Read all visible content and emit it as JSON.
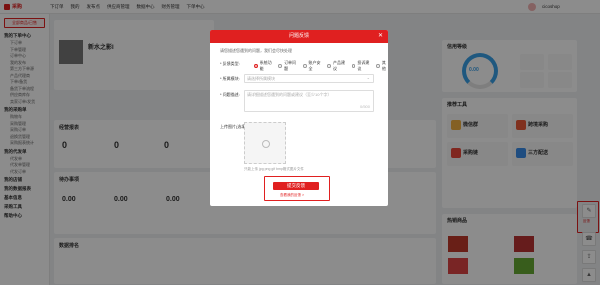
{
  "header": {
    "nav": [
      "下订单",
      "我的",
      "发布点",
      "供应商管理",
      "数据中心",
      "财务管理",
      "下单中心"
    ],
    "user": "cicoshop"
  },
  "sidebar": {
    "primary_button": "全部商品/已售",
    "groups": [
      {
        "title": "我的下单中心",
        "items": [
          "下订单",
          "下单管理",
          "订单中心",
          "我的发布",
          "第三方下单源",
          "产品代理商",
          "下单/备货",
          "备货下单流程",
          "供应商库存",
          "卖家订单/发货"
        ]
      },
      {
        "title": "我的采购单",
        "items": [
          "购物车",
          "采购管理",
          "采购订单",
          "退换货管理",
          "采购报表统计"
        ]
      },
      {
        "title": "我的代发单",
        "items": [
          "代发单",
          "代发单管理",
          "代发订单"
        ]
      },
      {
        "title": "我的店铺",
        "items": []
      },
      {
        "title": "我的数据报表",
        "items": []
      },
      {
        "title": "基本信息",
        "items": []
      },
      {
        "title": "采购工具",
        "items": []
      },
      {
        "title": "帮助中心",
        "items": []
      }
    ]
  },
  "profile": {
    "name": "新水之影I"
  },
  "sections": {
    "orders": "待办事项",
    "report": "经营报表",
    "ranking": "数据排名",
    "follow": "运营播报",
    "tools": "推荐工具",
    "hot": "热销商品"
  },
  "stats": {
    "a": "0",
    "b": "0",
    "c": "0",
    "d": "0.00",
    "e": "0.00",
    "f": "0.00"
  },
  "modal": {
    "title": "问题反馈",
    "intro": "请您描述您遇到的问题，我们会尽快处理",
    "type_label": "* 反馈类型:",
    "types": [
      "系统功能",
      "订单问题",
      "账户安全",
      "产品建议",
      "投诉建议",
      "其他"
    ],
    "selected_type": 0,
    "module_label": "* 所属模块:",
    "module_placeholder": "请选择所属模块",
    "desc_label": "* 问题描述:",
    "desc_placeholder": "请详细描述您遇到的问题或建议（至少10个字）",
    "desc_count": "0/500",
    "upload_label": "上传图片(选填):",
    "upload_tip": "只能上传 jpg png gif bmp格式图片文件",
    "submit": "提交反馈",
    "history": "查看我的反馈 >"
  },
  "tools": [
    {
      "name": "微信群"
    },
    {
      "name": "跨境采购"
    },
    {
      "name": "采购链"
    },
    {
      "name": "三方配送"
    }
  ],
  "gauge": {
    "value": "0.00",
    "label": "信用等级"
  },
  "right_tools": [
    "反馈",
    "客服",
    "分享",
    "返回"
  ]
}
